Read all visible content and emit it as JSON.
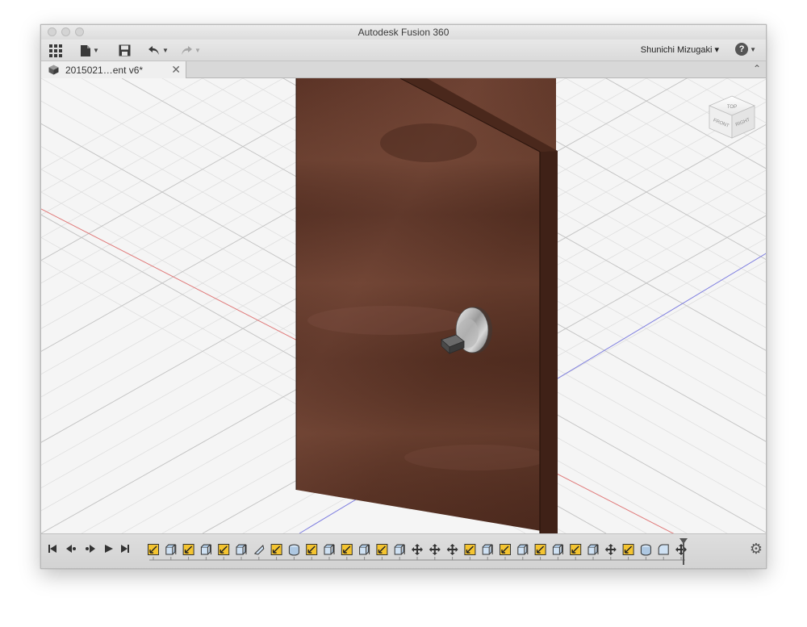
{
  "window": {
    "title": "Autodesk Fusion 360"
  },
  "toolbar": {
    "user_name": "Shunichi Mizugaki ▾",
    "icons": [
      "apps-grid-icon",
      "file-menu-icon",
      "save-icon",
      "undo-icon",
      "redo-icon",
      "help-icon"
    ]
  },
  "tab": {
    "label": "2015021…ent v6*",
    "close": "✕"
  },
  "viewcube": {
    "top": "TOP",
    "front": "FRONT",
    "right": "RIGHT"
  },
  "timeline": {
    "features": [
      "sketch",
      "extrude",
      "sketch",
      "extrude",
      "sketch",
      "extrude",
      "split",
      "sketch",
      "revolve",
      "sketch",
      "extrude",
      "sketch",
      "extrude",
      "sketch",
      "extrude",
      "move",
      "move",
      "move",
      "sketch",
      "extrude",
      "sketch",
      "extrude",
      "sketch",
      "extrude",
      "sketch",
      "extrude",
      "move",
      "sketch",
      "revolve",
      "fillet",
      "move",
      "appearance"
    ]
  }
}
